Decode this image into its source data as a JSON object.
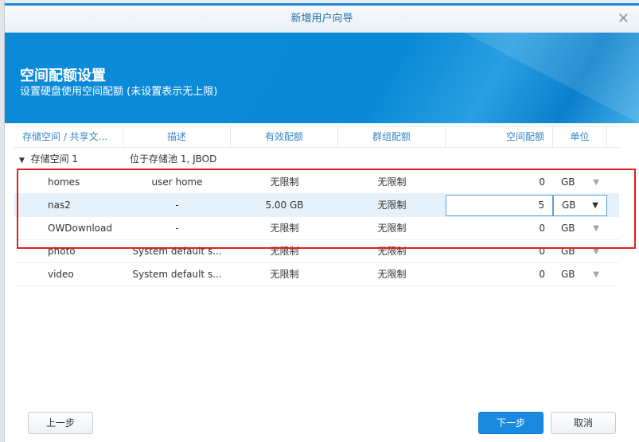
{
  "dialog": {
    "title": "新增用户向导",
    "close_icon": "close-icon"
  },
  "banner": {
    "title": "空间配额设置",
    "subtitle": "设置硬盘使用空间配额 (未设置表示无上限)"
  },
  "table": {
    "headers": [
      "存储空间 / 共享文...",
      "描述",
      "有效配额",
      "群组配额",
      "空间配额",
      "单位"
    ],
    "group": {
      "name": "存储空间 1",
      "desc": "位于存储池 1, JBOD"
    },
    "rows": [
      {
        "name": "homes",
        "desc": "user home",
        "effective": "无限制",
        "group": "无限制",
        "quota": "0",
        "unit": "GB"
      },
      {
        "name": "nas2",
        "desc": "-",
        "effective": "5.00 GB",
        "group": "无限制",
        "quota": "5",
        "unit": "GB"
      },
      {
        "name": "OWDownload",
        "desc": "-",
        "effective": "无限制",
        "group": "无限制",
        "quota": "0",
        "unit": "GB"
      },
      {
        "name": "photo",
        "desc": "System default s...",
        "effective": "无限制",
        "group": "无限制",
        "quota": "0",
        "unit": "GB"
      },
      {
        "name": "video",
        "desc": "System default s...",
        "effective": "无限制",
        "group": "无限制",
        "quota": "0",
        "unit": "GB"
      }
    ]
  },
  "footer": {
    "prev": "上一步",
    "next": "下一步",
    "cancel": "取消"
  },
  "colors": {
    "accent": "#1a8ae0",
    "highlight_box": "#e02020"
  }
}
